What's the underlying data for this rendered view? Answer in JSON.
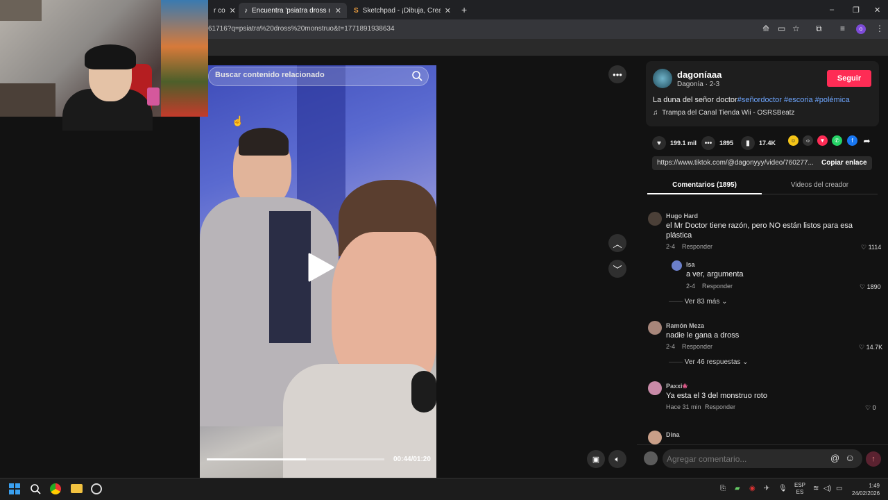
{
  "browser": {
    "tabs": [
      {
        "label": "r co",
        "active": false
      },
      {
        "label": "Encuentra 'psiatra dross monst",
        "active": true
      },
      {
        "label": "Sketchpad - ¡Dibuja, Crea, Com",
        "active": false
      }
    ],
    "new_tab": "+",
    "url": "61716?q=psiatra%20dross%20monstruo&t=1771891938634",
    "window_controls": {
      "minimize": "–",
      "restore": "❐",
      "close": "✕"
    }
  },
  "video": {
    "search_placeholder": "Buscar contenido relacionado",
    "progress": 0.56,
    "time": "00:44/01:20"
  },
  "creator": {
    "name": "dagoníaaa",
    "sub": "Dagonía · 2-3",
    "follow": "Seguir",
    "description": "La duna del señor doctor",
    "tags": [
      "#señordoctor",
      "#escoria",
      "#polémica"
    ],
    "music": "Trampa del Canal Tienda Wii - OSRSBeatz"
  },
  "stats": {
    "likes": "199.1 mil",
    "comments": "1895",
    "saves": "17.4K"
  },
  "link": {
    "url": "https://www.tiktok.com/@dagonyyy/video/760277...",
    "copy": "Copiar enlace"
  },
  "tabs": {
    "comments": "Comentarios (1895)",
    "videos": "Videos del creador"
  },
  "comments": [
    {
      "name": "Hugo Hard",
      "text": "el Mr Doctor tiene razón, pero NO están listos para esa plástica",
      "date": "2-4",
      "reply": "Responder",
      "likes": "1114"
    },
    {
      "name": "Isa",
      "text": "a ver, argumenta",
      "date": "2-4",
      "reply": "Responder",
      "likes": "1890"
    },
    {
      "more": "Ver 83 más"
    },
    {
      "name": "Ramón Meza",
      "text": "nadie le gana a dross",
      "date": "2-4",
      "reply": "Responder",
      "likes": "14.7K"
    },
    {
      "more": "Ver 46 respuestas"
    },
    {
      "name": "Paxxi",
      "text": "Ya esta el 3 del monstruo roto",
      "date": "Hace 31 min",
      "reply": "Responder",
      "likes": "0"
    },
    {
      "name": "Dina"
    }
  ],
  "comment_input": {
    "placeholder": "Agregar comentario..."
  },
  "taskbar": {
    "lang1": "ESP",
    "lang2": "ES",
    "time": "1:49",
    "date": "24/02/2026"
  },
  "colors": {
    "accent": "#fe2c55",
    "tag": "#6ea6ff"
  }
}
